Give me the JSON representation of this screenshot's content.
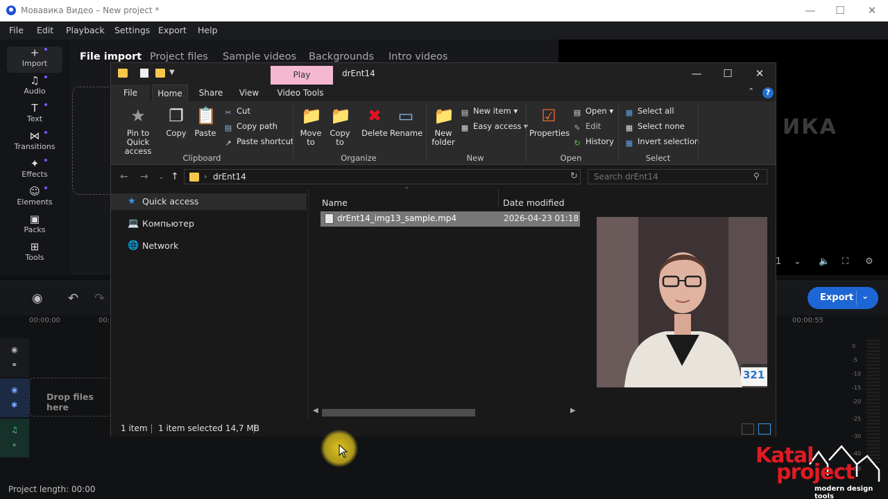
{
  "app": {
    "title": "Мовавика Видео – New project *",
    "menu": [
      "File",
      "Edit",
      "Playback",
      "Settings",
      "Export",
      "Help"
    ],
    "sidebar": [
      {
        "label": "Import",
        "icon": "plus-icon"
      },
      {
        "label": "Audio",
        "icon": "music-note-icon"
      },
      {
        "label": "Text",
        "icon": "text-icon"
      },
      {
        "label": "Transitions",
        "icon": "transitions-icon"
      },
      {
        "label": "Effects",
        "icon": "effects-icon"
      },
      {
        "label": "Elements",
        "icon": "elements-icon"
      },
      {
        "label": "Packs",
        "icon": "packs-icon"
      },
      {
        "label": "Tools",
        "icon": "tools-icon"
      }
    ],
    "tabs": [
      "File import",
      "Project files",
      "Sample videos",
      "Backgrounds",
      "Intro videos"
    ],
    "player_logo_text": "ИКА",
    "export_label": "Export",
    "timeline": {
      "ticks": [
        "00:00:00",
        "00:",
        "00:00:55"
      ],
      "drop_text": "Drop files here",
      "db_scale": [
        "0",
        "-5",
        "-10",
        "-15",
        "-20",
        "-25",
        "-30",
        "-40",
        "-50"
      ]
    },
    "project_length": "Project length: 00:00"
  },
  "explorer": {
    "play_tab": "Play",
    "title": "drEnt14",
    "ribbon_tabs": [
      "File",
      "Home",
      "Share",
      "View",
      "Video Tools"
    ],
    "active_tab": "Home",
    "groups": {
      "clipboard": {
        "label": "Clipboard",
        "pin": "Pin to Quick access",
        "copy": "Copy",
        "paste": "Paste",
        "cut": "Cut",
        "copy_path": "Copy path",
        "paste_shortcut": "Paste shortcut"
      },
      "organize": {
        "label": "Organize",
        "move_to": "Move to",
        "copy_to": "Copy to",
        "delete": "Delete",
        "rename": "Rename"
      },
      "new": {
        "label": "New",
        "new_folder": "New folder",
        "new_item": "New item",
        "easy_access": "Easy access"
      },
      "open": {
        "label": "Open",
        "properties": "Properties",
        "open": "Open",
        "edit": "Edit",
        "history": "History"
      },
      "select": {
        "label": "Select",
        "select_all": "Select all",
        "select_none": "Select none",
        "invert_selection": "Invert selection"
      }
    },
    "address": {
      "path": "drEnt14",
      "search_placeholder": "Search drEnt14"
    },
    "nav_pane": [
      "Quick access",
      "Компьютер",
      "Network"
    ],
    "columns": {
      "name": "Name",
      "date": "Date modified"
    },
    "files": [
      {
        "name": "drEnt14_img13_sample.mp4",
        "date": "2026-04-23 01:18"
      }
    ],
    "status": {
      "count": "1 item",
      "selected": "1 item selected  14,7 MB"
    },
    "preview_badge": "321"
  },
  "watermark": {
    "line1": "Katal",
    "line2": "project",
    "tagline": "modern design tools"
  },
  "colors": {
    "accent": "#1e66d6",
    "play_tab": "#f5b8d1",
    "watermark_red": "#e01b22"
  }
}
